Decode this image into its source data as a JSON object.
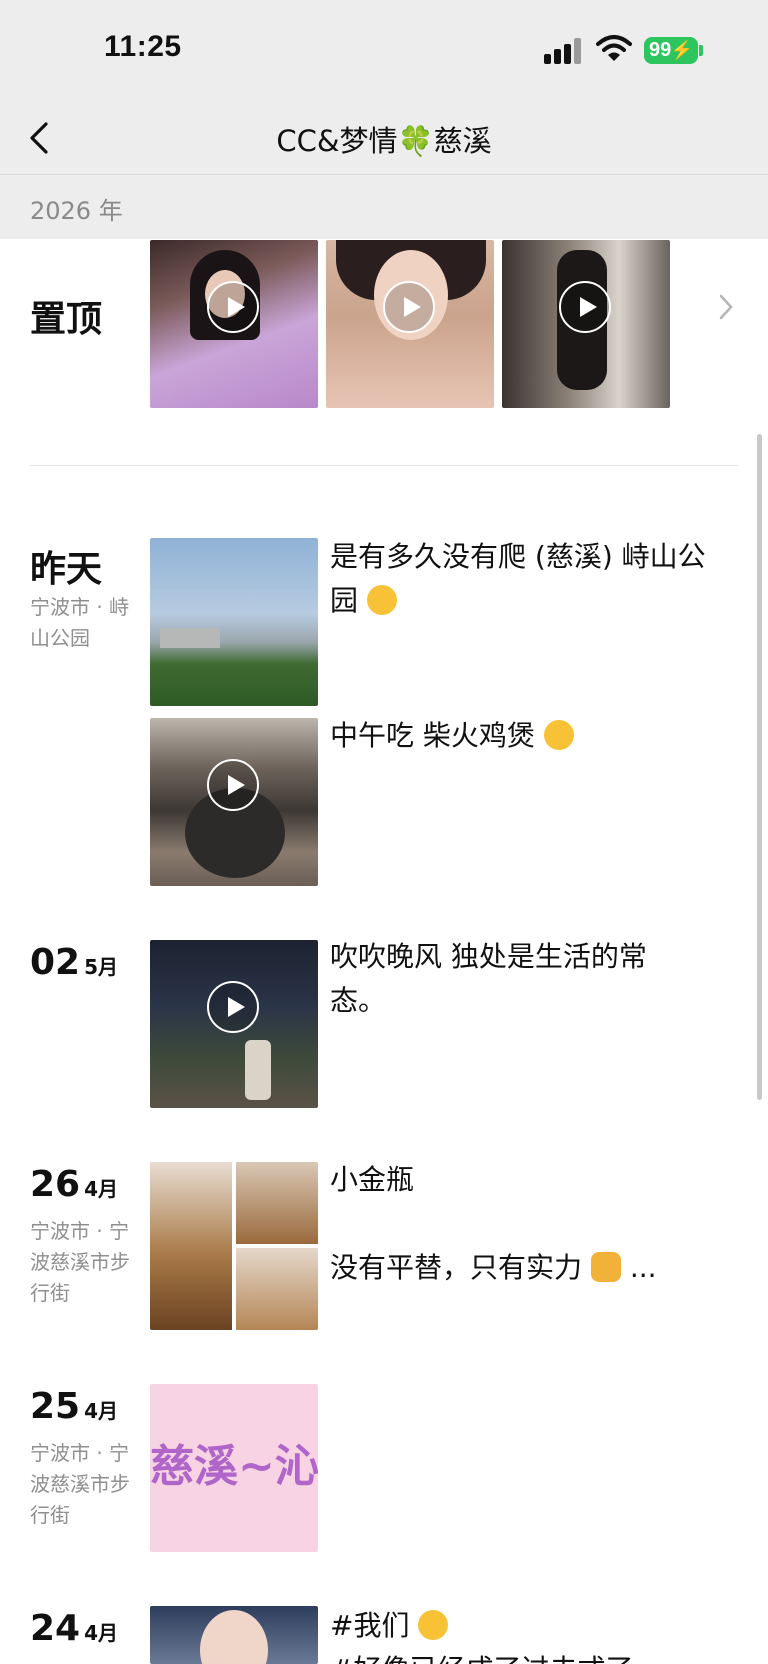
{
  "status": {
    "time": "11:25",
    "battery": "99"
  },
  "nav": {
    "title": "CC&梦情🍀慈溪"
  },
  "year": "2026 年",
  "pinned": {
    "label": "置顶"
  },
  "posts": [
    {
      "date": "昨天",
      "location": "宁波市 · 峙山公园",
      "caption1": "是有多久没有爬 (慈溪) 峙山公园",
      "caption2": "中午吃 柴火鸡煲"
    },
    {
      "day": "02",
      "month": "5月",
      "caption": "吹吹晚风  独处是生活的常态。"
    },
    {
      "day": "26",
      "month": "4月",
      "location": "宁波市 · 宁波慈溪市步行街",
      "caption_line1": "小金瓶",
      "caption_line2": "没有平替，只有实力",
      "ellipsis": "..."
    },
    {
      "day": "25",
      "month": "4月",
      "location": "宁波市 · 宁波慈溪市步行街",
      "image_text": "慈溪~沁"
    },
    {
      "day": "24",
      "month": "4月",
      "caption_line1": "#我们",
      "caption_line2": "#好像已经成了过去式了"
    }
  ],
  "icons": [
    "back-chevron-icon",
    "signal-icon",
    "wifi-icon",
    "battery-icon",
    "play-icon",
    "chevron-right-icon"
  ],
  "colors": {
    "header_bg": "#ededed",
    "battery_green": "#2dc55e",
    "secondary_text": "#8f8f8f"
  }
}
